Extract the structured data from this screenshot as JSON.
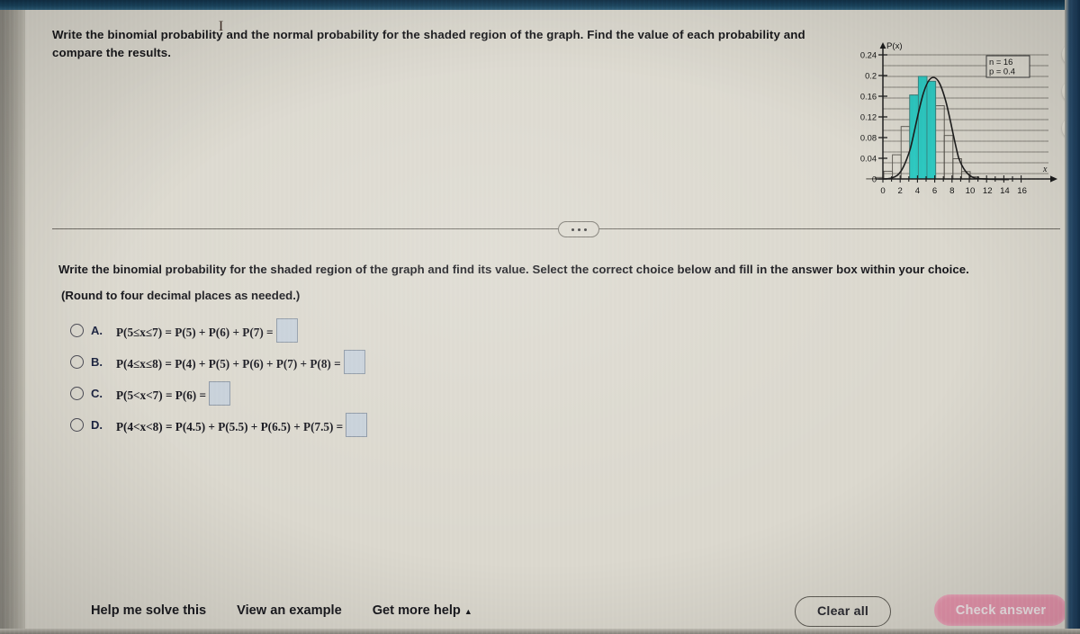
{
  "question": {
    "text": "Write the binomial probability and the normal probability for the shaded region of the graph. Find the value of each probability and compare the results.",
    "cursor_glyph": "I"
  },
  "graph": {
    "y_axis_label": "P(x)",
    "x_axis_label": "x",
    "legend": {
      "n_label": "n = 16",
      "p_label": "p = 0.4"
    },
    "shaded_color": "#28c8c0",
    "chart_data": {
      "type": "bar",
      "title": "",
      "xlabel": "x",
      "ylabel": "P(x)",
      "xlim": [
        0,
        17
      ],
      "ylim": [
        0,
        0.24
      ],
      "xticks": [
        0,
        2,
        4,
        6,
        8,
        10,
        12,
        14,
        16
      ],
      "yticks": [
        0,
        0.04,
        0.08,
        0.12,
        0.16,
        0.2,
        0.24
      ],
      "ytick_labels": [
        "0",
        "0.04",
        "0.08",
        "0.12",
        "0.16",
        "0.2",
        "0.24"
      ],
      "xtick_labels": [
        "0",
        "2",
        "4",
        "6",
        "8",
        "10",
        "12",
        "14",
        "16"
      ],
      "grid": true,
      "legend_position": "top-right",
      "categories": [
        0,
        1,
        2,
        3,
        4,
        5,
        6,
        7,
        8,
        9,
        10,
        11,
        12,
        13,
        14,
        15,
        16
      ],
      "values": [
        0.0003,
        0.003,
        0.015,
        0.0468,
        0.1014,
        0.1623,
        0.1983,
        0.1889,
        0.1417,
        0.084,
        0.0392,
        0.0142,
        0.004,
        0.0008,
        0.0001,
        0.0,
        0.0
      ],
      "shaded_categories": [
        5,
        6,
        7
      ],
      "shaded_range": [
        4.5,
        7.5
      ],
      "overlay_curve": "normal approximation, mean = 6.4, sd = 1.96"
    }
  },
  "toolbar_icons": [
    {
      "name": "zoom-in-icon",
      "label": "Zoom in"
    },
    {
      "name": "zoom-out-icon",
      "label": "Zoom out"
    },
    {
      "name": "open-in-new-icon",
      "label": "Open in new window"
    }
  ],
  "divider": {
    "ellipsis": "..."
  },
  "main": {
    "prompt": "Write the binomial probability for the shaded region of the graph and find its value. Select the correct choice below and fill in the answer box within your choice.",
    "rounding_note": "(Round to four decimal places as needed.)",
    "choices": [
      {
        "letter": "A.",
        "expression_parts": [
          "P(5≤x≤7) = P(5) + P(6) + P(7) =",
          ""
        ],
        "expression": "P(5≤x≤7) = P(5) + P(6) + P(7) =",
        "answer_value": "",
        "selected": false
      },
      {
        "letter": "B.",
        "expression": "P(4≤x≤8) = P(4) + P(5) + P(6) + P(7) + P(8) =",
        "answer_value": "",
        "selected": false
      },
      {
        "letter": "C.",
        "expression": "P(5<x<7) = P(6) =",
        "answer_value": "",
        "selected": false
      },
      {
        "letter": "D.",
        "expression": "P(4<x<8) = P(4.5) + P(5.5) + P(6.5) + P(7.5) =",
        "answer_value": "",
        "selected": false
      }
    ]
  },
  "footer": {
    "links": [
      {
        "label": "Help me solve this"
      },
      {
        "label": "View an example"
      },
      {
        "label": "Get more help",
        "caret": "▲"
      }
    ],
    "clear_all_label": "Clear all",
    "check_answer_label": "Check answer",
    "check_answer_color": "#e796ad"
  }
}
